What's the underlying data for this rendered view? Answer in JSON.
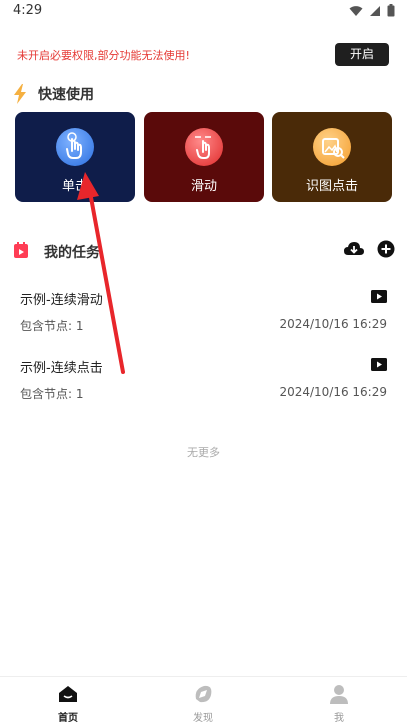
{
  "status": {
    "time": "4:29"
  },
  "permission_banner": {
    "text": "未开启必要权限,部分功能无法使用!",
    "button_label": "开启"
  },
  "quick_use": {
    "title": "快速使用",
    "cards": [
      {
        "label": "单击",
        "bg": "#0f1d4a",
        "icon": "tap-hand-icon"
      },
      {
        "label": "滑动",
        "bg": "#5a0a0a",
        "icon": "swipe-hand-icon"
      },
      {
        "label": "识图点击",
        "bg": "#4a2a08",
        "icon": "image-search-icon"
      }
    ]
  },
  "tasks": {
    "title": "我的任务",
    "items": [
      {
        "name": "示例-连续滑动",
        "nodes": "包含节点: 1",
        "time": "2024/10/16 16:29"
      },
      {
        "name": "示例-连续点击",
        "nodes": "包含节点: 1",
        "time": "2024/10/16 16:29"
      }
    ],
    "no_more": "无更多"
  },
  "bottom_nav": [
    {
      "label": "首页",
      "active": true,
      "icon": "home-icon"
    },
    {
      "label": "发现",
      "active": false,
      "icon": "discover-icon"
    },
    {
      "label": "我",
      "active": false,
      "icon": "profile-icon"
    }
  ],
  "colors": {
    "accent_red": "#e53935",
    "arrow": "#e8262b"
  }
}
